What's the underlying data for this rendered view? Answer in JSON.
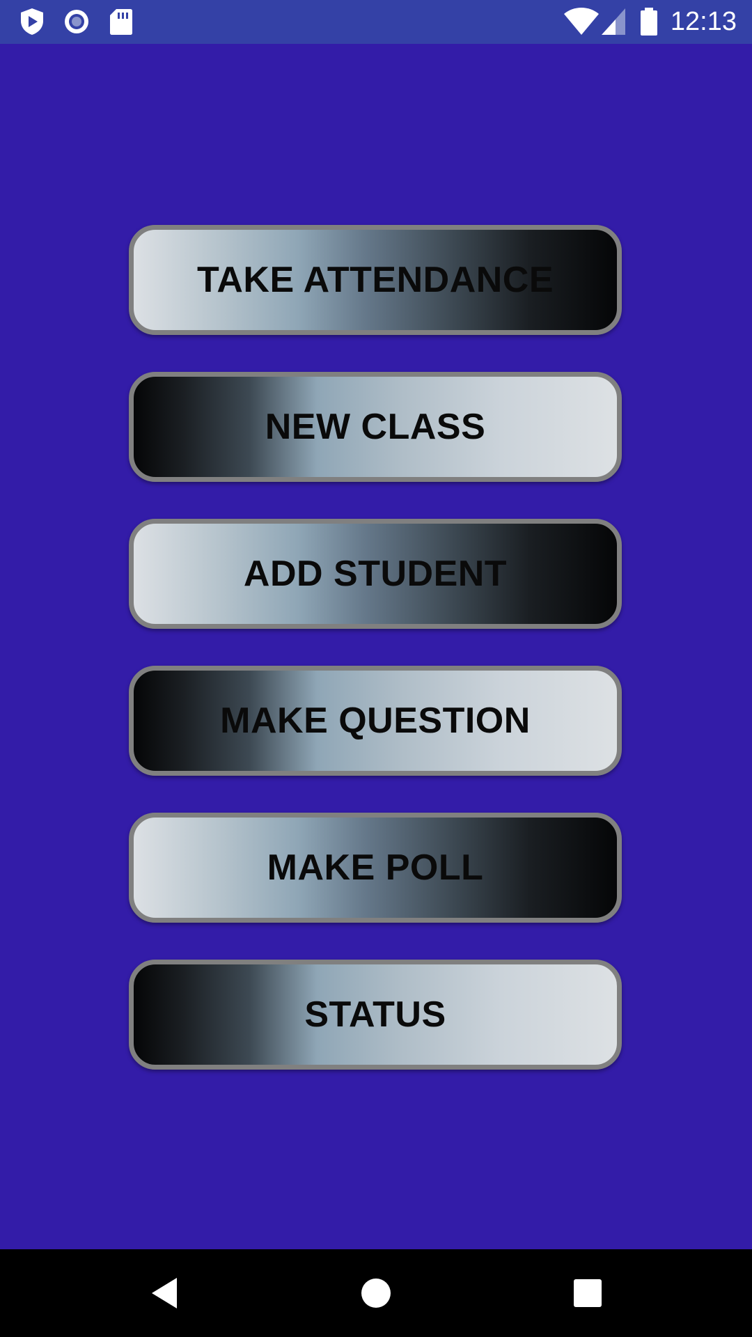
{
  "status_bar": {
    "time": "12:13",
    "left_icons": [
      "shield-play-icon",
      "record-circle-icon",
      "sd-card-icon"
    ],
    "right_icons": [
      "wifi-icon",
      "cell-signal-icon",
      "battery-icon"
    ]
  },
  "main": {
    "background_color": "#331CA8",
    "buttons": [
      {
        "label": "TAKE ATTENDANCE",
        "style": "light-left"
      },
      {
        "label": "NEW CLASS",
        "style": "dark-left"
      },
      {
        "label": "ADD STUDENT",
        "style": "light-left"
      },
      {
        "label": "MAKE QUESTION",
        "style": "dark-left"
      },
      {
        "label": "MAKE POLL",
        "style": "light-left"
      },
      {
        "label": "STATUS",
        "style": "dark-left"
      }
    ]
  },
  "nav_bar": {
    "icons": [
      "back-icon",
      "home-icon",
      "recents-icon"
    ]
  }
}
